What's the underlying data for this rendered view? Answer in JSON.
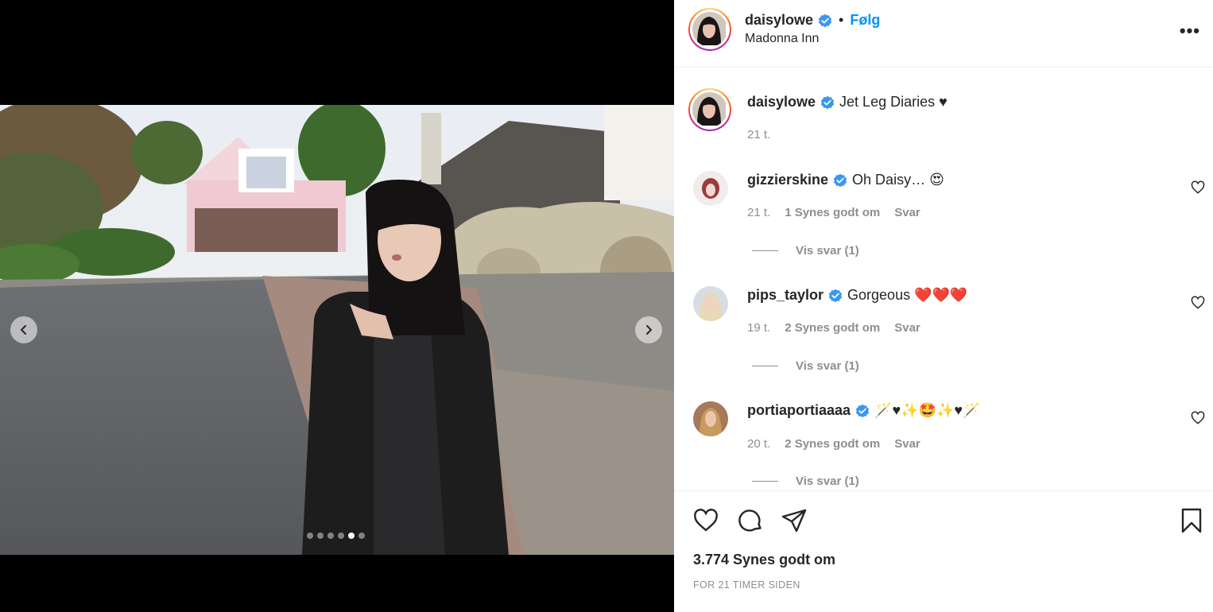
{
  "post": {
    "username": "daisylowe",
    "follow_label": "Følg",
    "separator": "•",
    "location": "Madonna Inn",
    "more_label": "•••",
    "caption": "Jet Leg Diaries ♥",
    "caption_time": "21 t.",
    "likes": "3.774 Synes godt om",
    "posted_ago": "FOR 21 TIMER SIDEN"
  },
  "carousel": {
    "slide_count": 6,
    "active_index": 4
  },
  "comments": [
    {
      "username": "gizzierskine",
      "text": "Oh Daisy… 😍",
      "time": "21 t.",
      "likes": "1 Synes godt om",
      "reply_label": "Svar",
      "view_replies": "Vis svar (1)"
    },
    {
      "username": "pips_taylor",
      "text": "Gorgeous ❤️❤️❤️",
      "time": "19 t.",
      "likes": "2 Synes godt om",
      "reply_label": "Svar",
      "view_replies": "Vis svar (1)"
    },
    {
      "username": "portiaportiaaaa",
      "text": "🪄♥✨🤩✨♥🪄",
      "time": "20 t.",
      "likes": "2 Synes godt om",
      "reply_label": "Svar",
      "view_replies": "Vis svar (1)"
    }
  ],
  "colors": {
    "accent": "#0095f6",
    "verified": "#3897f0",
    "secondary_text": "#8e8e8e"
  },
  "icons": {
    "like": "heart-icon",
    "comment": "comment-icon",
    "share": "share-icon",
    "save": "bookmark-icon",
    "prev": "chevron-left-icon",
    "next": "chevron-right-icon"
  }
}
